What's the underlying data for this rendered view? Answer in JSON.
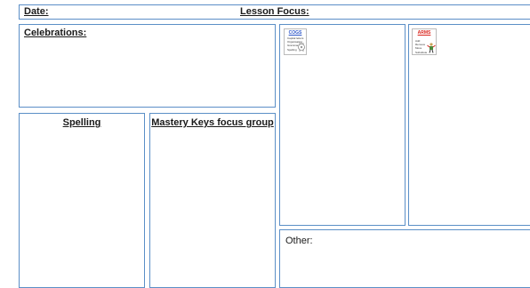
{
  "header": {
    "date_label": "Date:",
    "focus_label": "Lesson Focus:"
  },
  "sections": {
    "celebrations": "Celebrations:",
    "spelling": "Spelling",
    "mastery": "Mastery Keys focus group",
    "other": "Other:"
  },
  "cogs_card": {
    "title": "COGS",
    "items": [
      "Capital letters",
      "Organisation",
      "Grammar",
      "Spelling"
    ],
    "title_color": "#2b55c8",
    "icon": "cog-hand-icon"
  },
  "arms_card": {
    "title": "ARMS",
    "subtitle": "",
    "items": [
      "Add",
      "Remove",
      "Move",
      "Substitute"
    ],
    "title_color": "#d9241c",
    "icon": "robot-figure-icon"
  }
}
